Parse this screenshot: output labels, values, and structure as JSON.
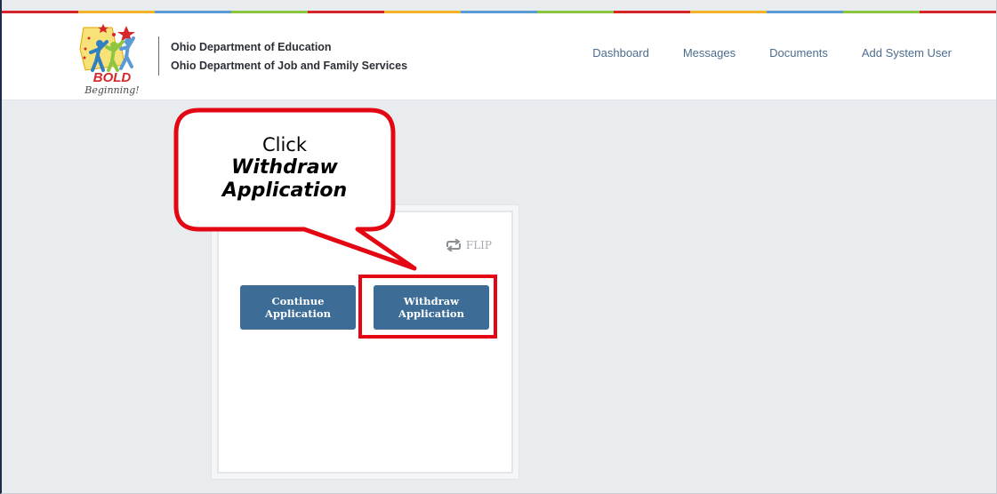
{
  "colors": {
    "stripe": [
      "#d6262a",
      "#f2b22a",
      "#5b9bd5",
      "#8cc63f",
      "#d6262a",
      "#f2b22a",
      "#5b9bd5",
      "#8cc63f",
      "#d6262a",
      "#f2b22a",
      "#5b9bd5",
      "#8cc63f",
      "#d6262a"
    ],
    "button": "#3d6d96",
    "highlight": "#e30613",
    "nav_link": "#4b6d8e"
  },
  "logo": {
    "title": "BOLD",
    "subtitle": "Beginning!"
  },
  "header": {
    "org_line1": "Ohio Department of Education",
    "org_line2": "Ohio Department of Job and Family Services"
  },
  "nav": {
    "items": [
      {
        "label": "Dashboard"
      },
      {
        "label": "Messages"
      },
      {
        "label": "Documents"
      },
      {
        "label": "Add System User"
      }
    ]
  },
  "card": {
    "flip_label": "FLIP",
    "continue_label": "Continue\nApplication",
    "withdraw_label": "Withdraw\nApplication"
  },
  "callout": {
    "line1": "Click",
    "line2": "Withdraw",
    "line3": "Application"
  }
}
